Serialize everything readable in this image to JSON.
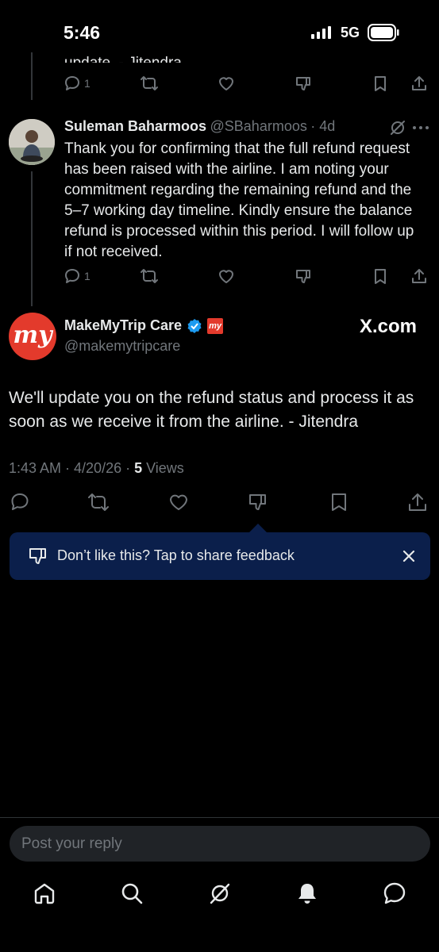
{
  "status_bar": {
    "time": "5:46",
    "network": "5G"
  },
  "prev_tweet": {
    "text_fragment": "update. - Jitendra",
    "reply_count": "1"
  },
  "reply_tweet": {
    "author_name": "Suleman Baharmoos",
    "handle": "@SBaharmoos",
    "age": "· 4d",
    "text": "Thank you for confirming that the full refund request has been raised with the airline. I am noting your commitment regarding the remaining refund and the 5–7 working day timeline. Kindly ensure the balance refund is processed within this period. I will follow up if not received.",
    "reply_count": "1"
  },
  "main_tweet": {
    "author_name": "MakeMyTrip Care",
    "handle": "@makemytripcare",
    "avatar_text": "my",
    "badge_text": "my",
    "watermark": "X.com",
    "text": "We'll update you on the refund status and process it as soon as we receive it from the airline. - Jitendra",
    "timestamp": "1:43 AM · 4/20/26 · ",
    "views_count": "5",
    "views_label": " Views"
  },
  "feedback_banner": {
    "text": "Don’t like this? Tap to share feedback"
  },
  "reply_bar": {
    "placeholder": "Post your reply"
  },
  "colors": {
    "background": "#000000",
    "accent": "#1d9bf0",
    "brand_red": "#e33a2c",
    "banner": "#0b1f4b"
  },
  "nav_icons": [
    "home-icon",
    "search-icon",
    "grok-icon",
    "notifications-icon",
    "messages-icon"
  ]
}
